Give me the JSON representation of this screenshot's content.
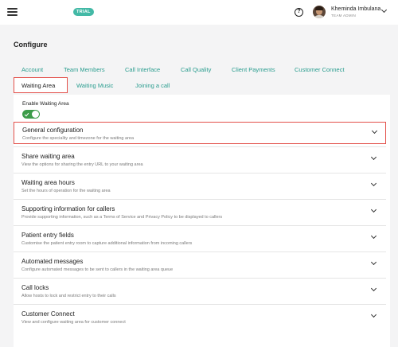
{
  "header": {
    "menu_icon": "hamburger-menu-icon",
    "badge": "TRIAL",
    "help_icon": "help-circle-icon",
    "help_glyph": "?",
    "user": {
      "name": "Kheminda Imbulana",
      "role": "TEAM ADMIN"
    }
  },
  "page": {
    "title": "Configure"
  },
  "tabs": [
    {
      "label": "Account"
    },
    {
      "label": "Team Members"
    },
    {
      "label": "Call Interface"
    },
    {
      "label": "Call Quality"
    },
    {
      "label": "Client Payments"
    },
    {
      "label": "Customer Connect"
    },
    {
      "label": "Waiting Area",
      "active": true
    },
    {
      "label": "Waiting Music"
    },
    {
      "label": "Joining a call"
    }
  ],
  "enable": {
    "label": "Enable Waiting Area",
    "on": true
  },
  "sections": [
    {
      "title": "General configuration",
      "desc": "Configure the speciality and timezone for the waiting area",
      "highlighted": true
    },
    {
      "title": "Share waiting area",
      "desc": "View the options for sharing the entry URL to your waiting area"
    },
    {
      "title": "Waiting area hours",
      "desc": "Set the hours of operation for the waiting area"
    },
    {
      "title": "Supporting information for callers",
      "desc": "Provide supporting information, such as a Terms of Service and Privacy Policy to be displayed to callers"
    },
    {
      "title": "Patient entry fields",
      "desc": "Customise the patient entry room to capture additional information from incoming callers"
    },
    {
      "title": "Automated messages",
      "desc": "Configure automated messages to be sent to callers in the waiting area queue"
    },
    {
      "title": "Call locks",
      "desc": "Allow hosts to lock and restrict entry to their calls"
    },
    {
      "title": "Customer Connect",
      "desc": "View and configure waiting area for customer connect"
    }
  ],
  "colors": {
    "accent": "#2a9d8f",
    "badge": "#43b9a6",
    "toggle": "#3d9c4a",
    "highlight": "#e3504a"
  }
}
